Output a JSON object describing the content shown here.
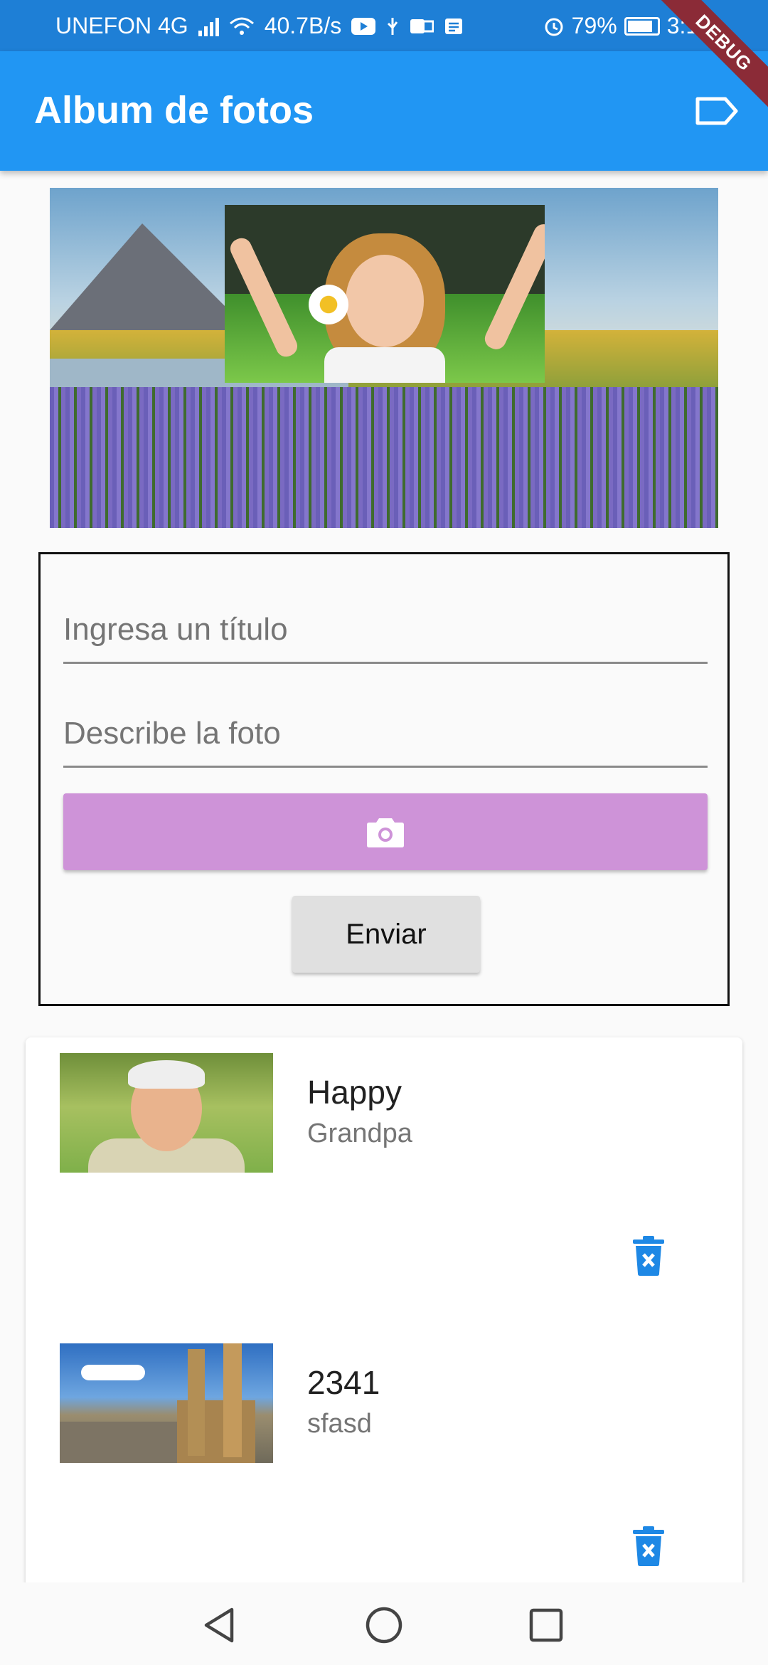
{
  "status_bar": {
    "carrier": "UNEFON 4G",
    "speed": "40.7B/s",
    "battery": "79%",
    "time": "3:12",
    "debug_banner": "DEBUG"
  },
  "app_bar": {
    "title": "Album de fotos",
    "action_icon": "label-outline-icon"
  },
  "form": {
    "title_placeholder": "Ingresa un título",
    "description_placeholder": "Describe la foto",
    "camera_icon": "camera-icon",
    "submit_label": "Enviar"
  },
  "photos": [
    {
      "title": "Happy",
      "description": "Grandpa"
    },
    {
      "title": "2341",
      "description": "sfasd"
    }
  ],
  "colors": {
    "app_bar": "#2196f3",
    "status_bar": "#1e7fd6",
    "camera_button": "#ce93d8",
    "submit_button": "#e0e0e0",
    "delete_icon": "#1e88e5"
  }
}
